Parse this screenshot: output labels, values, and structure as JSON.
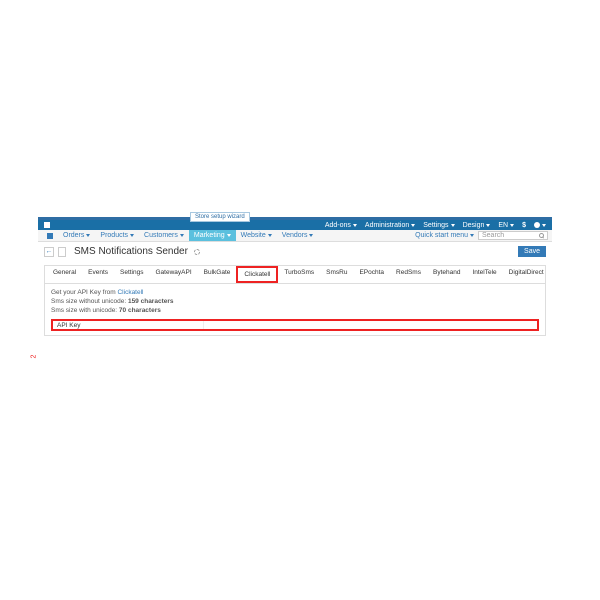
{
  "wizard": "Store setup wizard",
  "topnav": {
    "addons": "Add-ons",
    "administration": "Administration",
    "settings": "Settings",
    "design": "Design",
    "lang": "EN",
    "currency": "$"
  },
  "subnav": {
    "orders": "Orders",
    "products": "Products",
    "customers": "Customers",
    "marketing": "Marketing",
    "website": "Website",
    "vendors": "Vendors",
    "quick": "Quick start menu",
    "search_placeholder": "Search"
  },
  "header": {
    "back": "←",
    "title": "SMS Notifications Sender",
    "save": "Save"
  },
  "tabs": {
    "general": "General",
    "events": "Events",
    "settings": "Settings",
    "gatewayapi": "GatewayAPI",
    "bulkgate": "BulkGate",
    "clickatell": "Clickatell",
    "turbosms": "TurboSms",
    "smsru": "SmsRu",
    "epochta": "EPochta",
    "redsms": "RedSms",
    "bytehand": "Bytehand",
    "inteltele": "IntelTele",
    "digitaldirect": "DigitalDirect"
  },
  "content": {
    "info1_prefix": "Get your API Key from ",
    "info1_link": "Clickatell",
    "info2_prefix": "Sms size without unicode: ",
    "info2_bold": "159 characters",
    "info3_prefix": "Sms size with unicode: ",
    "info3_bold": "70 characters",
    "label_apikey": "API Key"
  },
  "marker": "2"
}
